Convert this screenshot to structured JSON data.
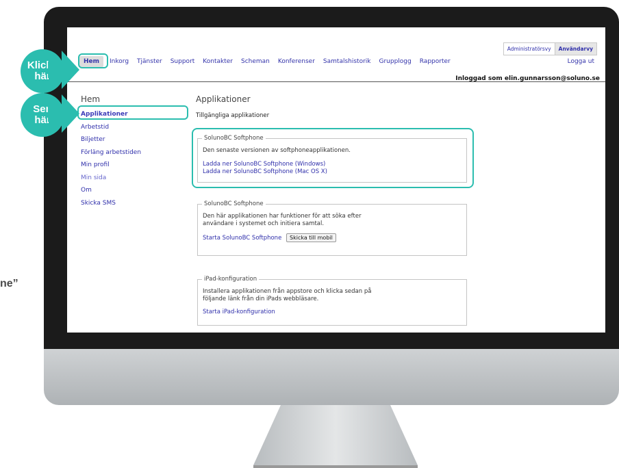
{
  "view_toggle": {
    "admin": "Administratörsvy",
    "user": "Användarvy"
  },
  "nav": {
    "items": [
      "Hem",
      "Inkorg",
      "Tjänster",
      "Support",
      "Kontakter",
      "Scheman",
      "Konferenser",
      "Samtalshistorik",
      "Grupplogg",
      "Rapporter"
    ],
    "logout": "Logga ut"
  },
  "user_line": "Inloggad som elin.gunnarsson@soluno.se",
  "sidebar": {
    "title": "Hem",
    "items": [
      "Applikationer",
      "Arbetstid",
      "Biljetter",
      "Förläng arbetstiden",
      "Min profil",
      "Min sida",
      "Om",
      "Skicka SMS"
    ]
  },
  "main": {
    "title": "Applikationer",
    "intro": "Tillgängliga applikationer",
    "box1": {
      "legend": "SolunoBC Softphone",
      "text": "Den senaste versionen av softphoneapplikationen.",
      "link_windows": "Ladda ner SolunoBC Softphone (Windows)",
      "link_mac": "Ladda ner SolunoBC Softphone (Mac OS X)"
    },
    "box2": {
      "legend": "SolunoBC Softphone",
      "text_line1": "Den här applikationen har funktioner för att söka efter",
      "text_line2": "användare i systemet och initiera samtal.",
      "link_start": "Starta SolunoBC Softphone",
      "button_mobile": "Skicka till mobil"
    },
    "box3": {
      "legend": "iPad-konfiguration",
      "text_line1": "Installera applikationen från appstore och klicka sedan på",
      "text_line2": "följande länk från din iPads webbläsare.",
      "link_start": "Starta iPad-konfiguration"
    }
  },
  "callouts": {
    "first_line1": "Klicka",
    "first_line2": "här",
    "second_line1": "Sen",
    "second_line2": "här"
  },
  "edge_text": "ne”",
  "colors": {
    "accent": "#2bbdaf",
    "link": "#2e2eaa",
    "bezel": "#1b1b1b"
  }
}
